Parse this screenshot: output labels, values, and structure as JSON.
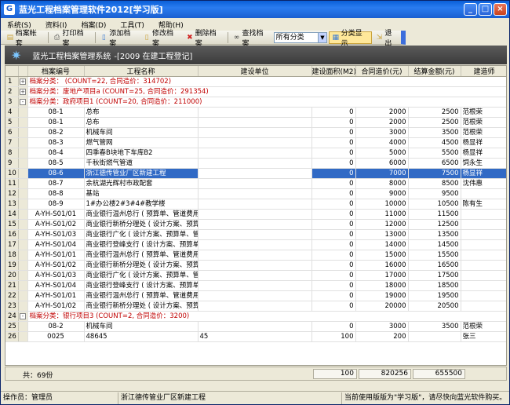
{
  "window": {
    "title": "蓝光工程档案管理软件2012[学习版]",
    "app_icon": "G"
  },
  "menu": [
    "系统(S)",
    "资料(I)",
    "档案(D)",
    "工具(T)",
    "帮助(H)"
  ],
  "toolbar": {
    "buttons": [
      "档案帐套",
      "打印档案",
      "添加档案",
      "修改档案",
      "删除档案",
      "查找档案"
    ],
    "category_select": "所有分类",
    "toggle_label": "分类显示",
    "exit_label": "退出"
  },
  "banner": {
    "title": "蓝光工程档案管理系统",
    "subtitle": "-[2009 在建工程登记]"
  },
  "table": {
    "columns": [
      "档案编号",
      "工程名称",
      "建设单位",
      "建设面积(M2)",
      "合同造价(元)",
      "结算金额(元)",
      "建造师"
    ],
    "rows": [
      {
        "no": "1",
        "type": "group",
        "toggle": "+",
        "text": "档案分类：  (COUNT=22, 合同造价：314702)"
      },
      {
        "no": "2",
        "type": "group",
        "toggle": "+",
        "text": "档案分类：废地产项目a (COUNT=25, 合同造价：291354)"
      },
      {
        "no": "3",
        "type": "group",
        "toggle": "-",
        "text": "档案分类：政府项目1 (COUNT=20, 合同造价：211000)"
      },
      {
        "no": "4",
        "type": "data",
        "code": "08-1",
        "name": "总布",
        "unit": "",
        "area": "0",
        "contract": "2000",
        "settle": "2500",
        "builder": "范根荣"
      },
      {
        "no": "5",
        "type": "data",
        "code": "08-1",
        "name": "总布",
        "unit": "",
        "area": "0",
        "contract": "2000",
        "settle": "2500",
        "builder": "范根荣"
      },
      {
        "no": "6",
        "type": "data",
        "code": "08-2",
        "name": "机械车间",
        "unit": "",
        "area": "0",
        "contract": "3000",
        "settle": "3500",
        "builder": "范根荣"
      },
      {
        "no": "7",
        "type": "data",
        "code": "08-3",
        "name": "燃气管网",
        "unit": "",
        "area": "0",
        "contract": "4000",
        "settle": "4500",
        "builder": "杨显祥"
      },
      {
        "no": "8",
        "type": "data",
        "code": "08-4",
        "name": "四季春B块地下车库B2",
        "unit": "",
        "area": "0",
        "contract": "5000",
        "settle": "5500",
        "builder": "杨显祥"
      },
      {
        "no": "9",
        "type": "data",
        "code": "08-5",
        "name": "千秋街燃气管道",
        "unit": "",
        "area": "0",
        "contract": "6000",
        "settle": "6500",
        "builder": "饲永生"
      },
      {
        "no": "10",
        "type": "data",
        "selected": true,
        "code": "08-6",
        "name": "浙江德传管业厂区新建工程",
        "unit": "",
        "area": "0",
        "contract": "7000",
        "settle": "7500",
        "builder": "杨显祥"
      },
      {
        "no": "11",
        "type": "data",
        "code": "08-7",
        "name": "余杭湖光辉村市政配套",
        "unit": "",
        "area": "0",
        "contract": "8000",
        "settle": "8500",
        "builder": "沈伟惠"
      },
      {
        "no": "12",
        "type": "data",
        "code": "08-8",
        "name": "基站",
        "unit": "",
        "area": "0",
        "contract": "9000",
        "settle": "9500",
        "builder": ""
      },
      {
        "no": "13",
        "type": "data",
        "code": "08-9",
        "name": "1#办公楼2#3#4#教学楼",
        "unit": "",
        "area": "0",
        "contract": "10000",
        "settle": "10500",
        "builder": "陈有生"
      },
      {
        "no": "14",
        "type": "data",
        "code": "A-YH-S01/01",
        "name": "商业银行温州总行 ( 预算单、管道费用",
        "unit": "",
        "area": "0",
        "contract": "11000",
        "settle": "11500",
        "builder": ""
      },
      {
        "no": "15",
        "type": "data",
        "code": "A-YH-S01/02",
        "name": "商业银行新桥分理处 ( 设计方案、预算",
        "unit": "",
        "area": "0",
        "contract": "12000",
        "settle": "12500",
        "builder": ""
      },
      {
        "no": "16",
        "type": "data",
        "code": "A-YH-S01/03",
        "name": "商业银行广化 ( 设计方案、预算单、管",
        "unit": "",
        "area": "0",
        "contract": "13000",
        "settle": "13500",
        "builder": ""
      },
      {
        "no": "17",
        "type": "data",
        "code": "A-YH-S01/04",
        "name": "商业银行登峰支行 ( 设计方案、预算单",
        "unit": "",
        "area": "0",
        "contract": "14000",
        "settle": "14500",
        "builder": ""
      },
      {
        "no": "18",
        "type": "data",
        "code": "A-YH-S01/01",
        "name": "商业银行温州总行 ( 预算单、管道费用",
        "unit": "",
        "area": "0",
        "contract": "15000",
        "settle": "15500",
        "builder": ""
      },
      {
        "no": "19",
        "type": "data",
        "code": "A-YH-S01/02",
        "name": "商业银行新桥分理处 ( 设计方案、预算",
        "unit": "",
        "area": "0",
        "contract": "16000",
        "settle": "16500",
        "builder": ""
      },
      {
        "no": "20",
        "type": "data",
        "code": "A-YH-S01/03",
        "name": "商业银行广化 ( 设计方案、预算单、管",
        "unit": "",
        "area": "0",
        "contract": "17000",
        "settle": "17500",
        "builder": ""
      },
      {
        "no": "21",
        "type": "data",
        "code": "A-YH-S01/04",
        "name": "商业银行登峰支行 ( 设计方案、预算单",
        "unit": "",
        "area": "0",
        "contract": "18000",
        "settle": "18500",
        "builder": ""
      },
      {
        "no": "22",
        "type": "data",
        "code": "A-YH-S01/01",
        "name": "商业银行温州总行 ( 预算单、管道费用",
        "unit": "",
        "area": "0",
        "contract": "19000",
        "settle": "19500",
        "builder": ""
      },
      {
        "no": "23",
        "type": "data",
        "code": "A-YH-S01/02",
        "name": "商业银行新桥分理处 ( 设计方案、预算",
        "unit": "",
        "area": "0",
        "contract": "20000",
        "settle": "20500",
        "builder": ""
      },
      {
        "no": "24",
        "type": "group",
        "toggle": "-",
        "text": "档案分类：银行项目3 (COUNT=2, 合同造价：3200)"
      },
      {
        "no": "25",
        "type": "data",
        "code": "08-2",
        "name": "机械车间",
        "unit": "",
        "area": "0",
        "contract": "3000",
        "settle": "3500",
        "builder": "范根荣"
      },
      {
        "no": "26",
        "type": "data",
        "code": "0025",
        "name": "48645",
        "unit": "45",
        "area": "100",
        "contract": "200",
        "settle": "",
        "builder": "张三"
      }
    ]
  },
  "footer": {
    "count": "共：69份",
    "area_total": "100",
    "contract_total": "820256",
    "settle_total": "655500"
  },
  "statusbar": {
    "operator": "操作员：管理员",
    "current": "浙江德传管业厂区新建工程",
    "notice": "当前使用版版为\"学习版\"，请尽快向蓝光软件购买。"
  },
  "colors": {
    "title_bar": "#1a5fd0",
    "selection": "#316ac5",
    "group_text": "#c00000",
    "banner_bg": "#4b4b4b"
  }
}
